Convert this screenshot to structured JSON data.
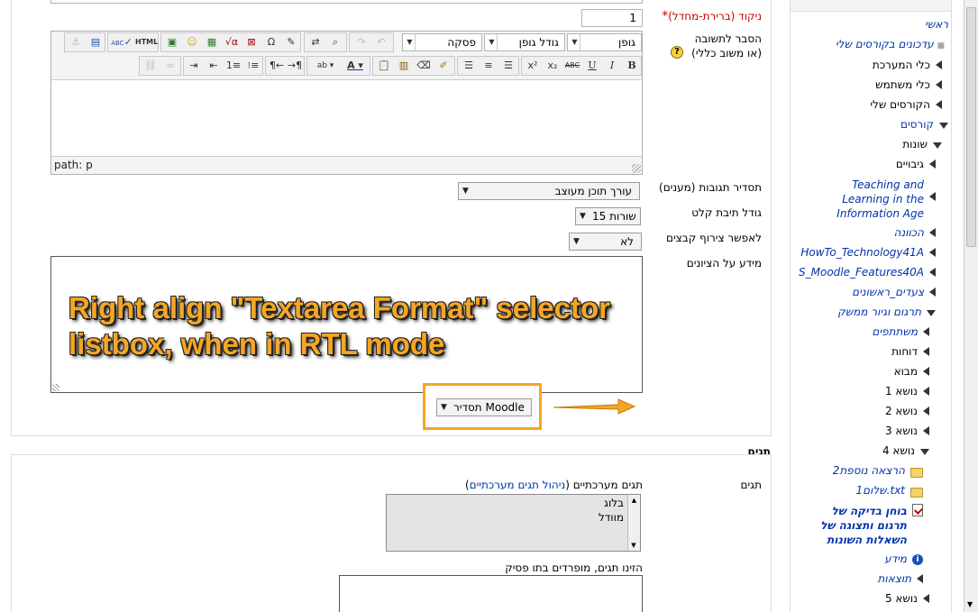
{
  "form": {
    "score_label": "ניקוד (ברירת-מחדל)",
    "required_mark": "*",
    "score_value": "1",
    "feedback_label_line1": "הסבר לתשובה",
    "feedback_label_line2": "(או משוב כללי)",
    "editor_path": "path: p",
    "font_placeholder": "גופן",
    "font_size_placeholder": "גודל גופן",
    "paragraph_placeholder": "פסקה",
    "answer_format_label": "תסדיר תגובות (מענים)",
    "answer_format_value": "עורך תוכן מעוצב",
    "input_size_label": "גודל תיבת קלט",
    "input_size_value": "15 שורות",
    "allow_attachments_label": "לאפשר צירוף קבצים",
    "allow_attachments_value": "לא",
    "grader_info_label": "מידע על הציונים",
    "textarea_format_value": "תסדיר Moodle",
    "annotation": "Right align \"Textarea Format\" selector listbox, when in RTL mode"
  },
  "toolbar": {
    "row1_right": [
      "B",
      "I",
      "U",
      "ABC",
      "x₂",
      "x²"
    ],
    "html_label": "HTML",
    "abc_label": "ABC"
  },
  "tags": {
    "section_title": "תגים",
    "tags_label": "תגים",
    "official_label": "תגים מערכתיים",
    "manage_link": "ניהול תגים מערכתיים",
    "official_items": [
      "בלוג",
      "מוודל"
    ],
    "other_label": "הזינו תגים, מופרדים בתו פסיק"
  },
  "sidebar": {
    "home": "ראשי",
    "course_updates": "עדכונים בקורסים שלי",
    "items": [
      {
        "label": "כלי המערכת",
        "type": "collapsed"
      },
      {
        "label": "כלי משתמש",
        "type": "collapsed"
      },
      {
        "label": "הקורסים שלי",
        "type": "collapsed"
      },
      {
        "label": "קורסים",
        "type": "expanded-link"
      },
      {
        "label": "שונות",
        "type": "expanded"
      },
      {
        "label": "גיבויים",
        "type": "collapsed"
      },
      {
        "label": "Teaching and Learning in the Information Age",
        "type": "collapsed-link-italic"
      },
      {
        "label": "הכוונה",
        "type": "collapsed-link-italic"
      },
      {
        "label": "HowTo_Technology41A",
        "type": "collapsed-link-italic"
      },
      {
        "label": "S_Moodle_Features40A",
        "type": "collapsed-link-italic"
      },
      {
        "label": "צעדים_ראשונים",
        "type": "collapsed-link-italic"
      },
      {
        "label": "תרגום וגיור ממשק",
        "type": "expanded-link-italic"
      },
      {
        "label": "משתתפים",
        "type": "collapsed-link-italic"
      },
      {
        "label": "דוחות",
        "type": "collapsed"
      },
      {
        "label": "מבוא",
        "type": "collapsed"
      },
      {
        "label": "נושא 1",
        "type": "collapsed"
      },
      {
        "label": "נושא 2",
        "type": "collapsed"
      },
      {
        "label": "נושא 3",
        "type": "collapsed"
      },
      {
        "label": "נושא 4",
        "type": "expanded"
      },
      {
        "label": "הרצאה נוספת2",
        "type": "folder"
      },
      {
        "label": "שלום1.txt",
        "type": "folder"
      },
      {
        "label": "בוחן בדיקה של תרגום ותצוגה של השאלות השונות",
        "type": "quiz"
      },
      {
        "label": "מידע",
        "type": "info"
      },
      {
        "label": "תוצאות",
        "type": "collapsed-link-italic"
      },
      {
        "label": "נושא 5",
        "type": "collapsed"
      }
    ]
  },
  "colors": {
    "link": "#0033aa",
    "required": "#cc0000",
    "annotation_text": "#f5a623",
    "highlight_box": "#f5a623"
  }
}
